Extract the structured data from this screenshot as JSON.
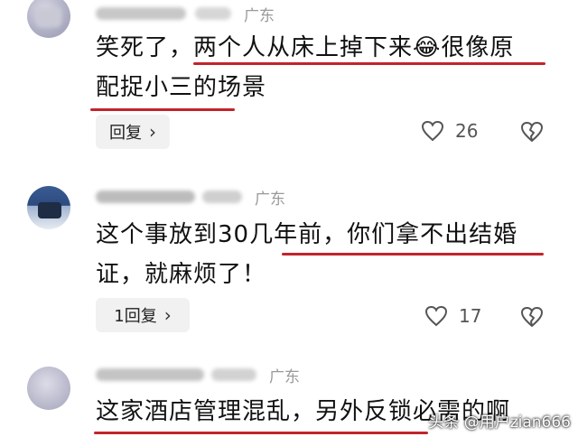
{
  "comments": [
    {
      "region": "广东",
      "text_lines": [
        "笑死了，两个人从床上掉下来😂很像原",
        "配捉小三的场景"
      ],
      "reply_label": "回复",
      "likes": "26"
    },
    {
      "region": "广东",
      "text_lines": [
        "这个事放到30几年前，你们拿不出结婚",
        "证，就麻烦了！"
      ],
      "reply_label": "1回复",
      "likes": "17"
    },
    {
      "region": "广东",
      "text_lines": [
        "这家酒店管理混乱，另外反锁必需的啊"
      ]
    }
  ],
  "watermark": "头条 @用户zian666",
  "colors": {
    "underline": "#c2242c",
    "region": "#9a9a9a",
    "reply_bg": "#f1f1f1"
  },
  "icons": {
    "like": "heart-outline-icon",
    "dislike": "broken-heart-icon",
    "reply": "chevron-right-icon"
  }
}
